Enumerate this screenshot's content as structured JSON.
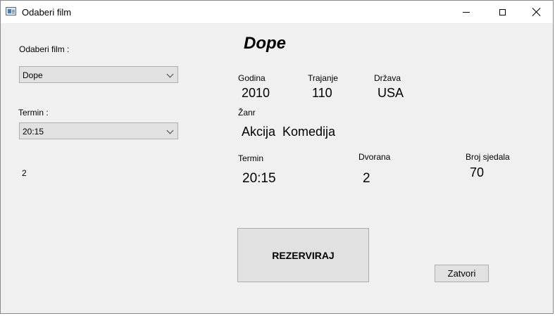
{
  "window": {
    "title": "Odaberi film"
  },
  "left": {
    "film_label": "Odaberi film :",
    "film_selected": "Dope",
    "termin_label": "Termin :",
    "termin_selected": "20:15",
    "info_number": "2"
  },
  "details": {
    "movie_title": "Dope",
    "godina_label": "Godina",
    "godina_value": "2010",
    "trajanje_label": "Trajanje",
    "trajanje_value": "110",
    "drzava_label": "Država",
    "drzava_value": "USA",
    "zanr_label": "Žanr",
    "zanr_value": "Akcija  Komedija",
    "termin_label": "Termin",
    "termin_value": "20:15",
    "dvorana_label": "Dvorana",
    "dvorana_value": "2",
    "sjedala_label": "Broj sjedala",
    "sjedala_value": "70"
  },
  "actions": {
    "reserve_label": "REZERVIRAJ",
    "close_label": "Zatvori"
  }
}
